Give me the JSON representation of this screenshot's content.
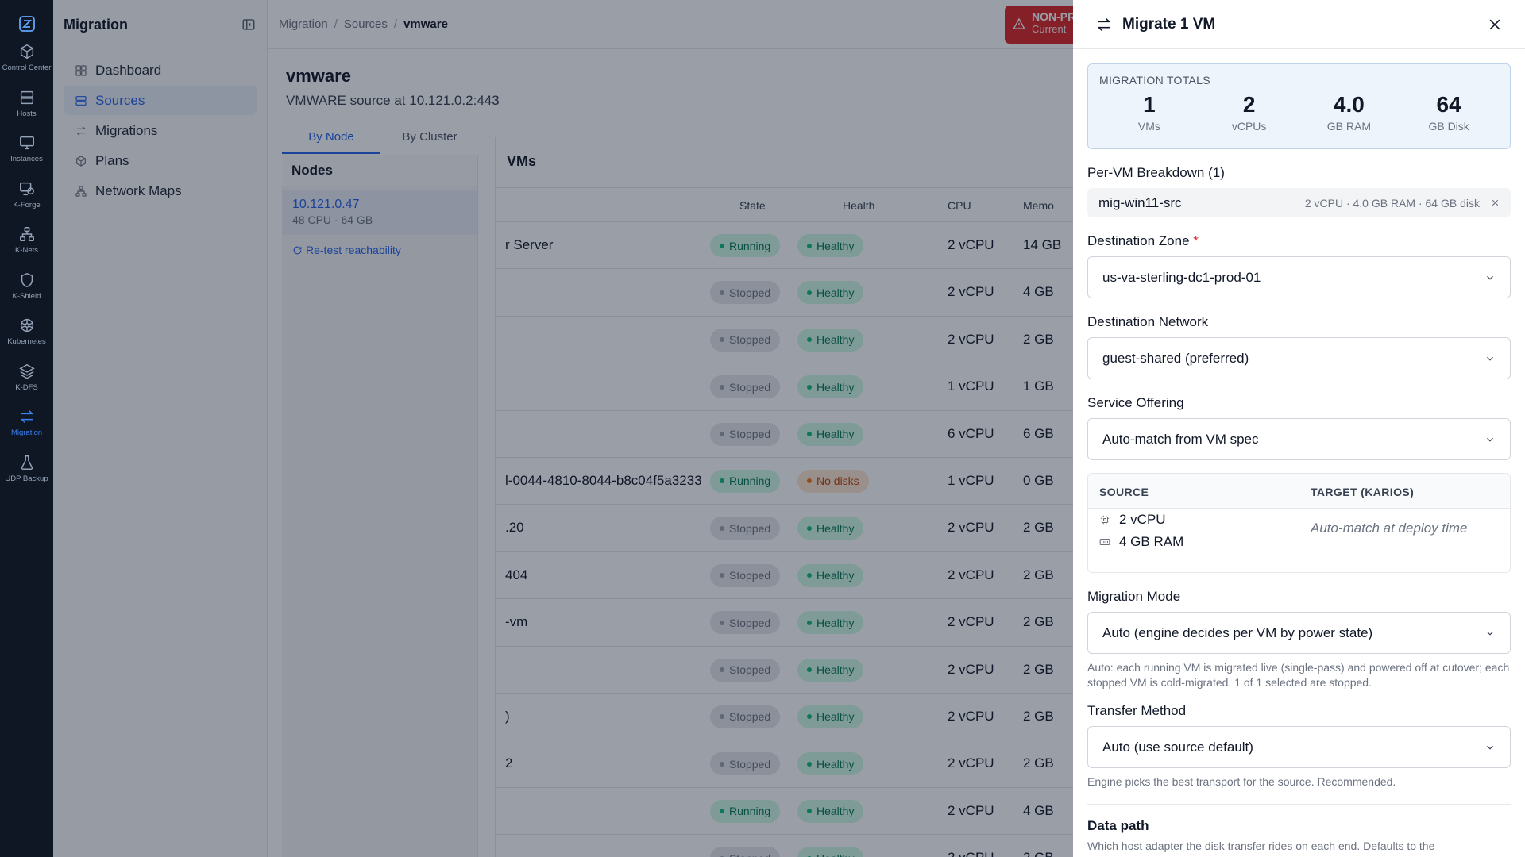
{
  "rail": {
    "items": [
      {
        "label": "Control Center",
        "icon": "cube-icon"
      },
      {
        "label": "Hosts",
        "icon": "server-icon"
      },
      {
        "label": "Instances",
        "icon": "monitor-icon"
      },
      {
        "label": "K-Forge",
        "icon": "forge-icon"
      },
      {
        "label": "K-Nets",
        "icon": "network-icon"
      },
      {
        "label": "K-Shield",
        "icon": "shield-icon"
      },
      {
        "label": "Kubernetes",
        "icon": "kubernetes-icon"
      },
      {
        "label": "K-DFS",
        "icon": "layers-icon"
      },
      {
        "label": "Migration",
        "icon": "swap-icon"
      },
      {
        "label": "UDP Backup",
        "icon": "flask-icon"
      }
    ]
  },
  "nav": {
    "title": "Migration",
    "items": [
      {
        "label": "Dashboard"
      },
      {
        "label": "Sources"
      },
      {
        "label": "Migrations"
      },
      {
        "label": "Plans"
      },
      {
        "label": "Network Maps"
      }
    ]
  },
  "breadcrumb": {
    "c1": "Migration",
    "c2": "Sources",
    "c3": "vmware",
    "sep": "/"
  },
  "alert": {
    "title": "NON-PR",
    "text": "Current"
  },
  "page": {
    "title": "vmware",
    "subtitle": "VMWARE source at 10.121.0.2:443"
  },
  "tabs": {
    "by_node": "By Node",
    "by_cluster": "By Cluster"
  },
  "nodes": {
    "heading": "Nodes",
    "item": {
      "ip": "10.121.0.47",
      "meta": "48 CPU · 64 GB"
    },
    "retest": "Re-test reachability"
  },
  "vms": {
    "heading": "VMs",
    "columns": {
      "state": "State",
      "health": "Health",
      "cpu": "CPU",
      "memory": "Memo"
    },
    "rows": [
      {
        "name": "r Server",
        "state": "Running",
        "health": "Healthy",
        "cpu": "2 vCPU",
        "mem": "14 GB"
      },
      {
        "name": "",
        "state": "Stopped",
        "health": "Healthy",
        "cpu": "2 vCPU",
        "mem": "4 GB"
      },
      {
        "name": "",
        "state": "Stopped",
        "health": "Healthy",
        "cpu": "2 vCPU",
        "mem": "2 GB"
      },
      {
        "name": "",
        "state": "Stopped",
        "health": "Healthy",
        "cpu": "1 vCPU",
        "mem": "1 GB"
      },
      {
        "name": "",
        "state": "Stopped",
        "health": "Healthy",
        "cpu": "6 vCPU",
        "mem": "6 GB"
      },
      {
        "name": "l-0044-4810-8044-b8c04f5a3233",
        "state": "Running",
        "health": "No disks",
        "cpu": "1 vCPU",
        "mem": "0 GB"
      },
      {
        "name": ".20",
        "state": "Stopped",
        "health": "Healthy",
        "cpu": "2 vCPU",
        "mem": "2 GB"
      },
      {
        "name": "404",
        "state": "Stopped",
        "health": "Healthy",
        "cpu": "2 vCPU",
        "mem": "2 GB"
      },
      {
        "name": "-vm",
        "state": "Stopped",
        "health": "Healthy",
        "cpu": "2 vCPU",
        "mem": "2 GB"
      },
      {
        "name": "",
        "state": "Stopped",
        "health": "Healthy",
        "cpu": "2 vCPU",
        "mem": "2 GB"
      },
      {
        "name": ")",
        "state": "Stopped",
        "health": "Healthy",
        "cpu": "2 vCPU",
        "mem": "2 GB"
      },
      {
        "name": "2",
        "state": "Stopped",
        "health": "Healthy",
        "cpu": "2 vCPU",
        "mem": "2 GB"
      },
      {
        "name": "",
        "state": "Running",
        "health": "Healthy",
        "cpu": "2 vCPU",
        "mem": "4 GB"
      },
      {
        "name": "",
        "state": "Stopped",
        "health": "Healthy",
        "cpu": "2 vCPU",
        "mem": "2 GB"
      }
    ]
  },
  "drawer": {
    "title": "Migrate 1 VM",
    "totals": {
      "label": "MIGRATION TOTALS",
      "items": [
        {
          "num": "1",
          "label": "VMs"
        },
        {
          "num": "2",
          "label": "vCPUs"
        },
        {
          "num": "4.0",
          "label": "GB RAM"
        },
        {
          "num": "64",
          "label": "GB Disk"
        }
      ]
    },
    "breakdown": {
      "label": "Per-VM Breakdown (1)",
      "vm_name": "mig-win11-src",
      "vm_spec": "2 vCPU · 4.0 GB RAM · 64 GB disk"
    },
    "zone": {
      "label": "Destination Zone",
      "required": "*",
      "value": "us-va-sterling-dc1-prod-01"
    },
    "network": {
      "label": "Destination Network",
      "value": "guest-shared (preferred)"
    },
    "offering": {
      "label": "Service Offering",
      "value": "Auto-match from VM spec"
    },
    "st": {
      "source_h": "SOURCE",
      "target_h": "TARGET (KARIOS)",
      "cpu": "2 vCPU",
      "ram": "4 GB RAM",
      "target": "Auto-match at deploy time"
    },
    "mode": {
      "label": "Migration Mode",
      "value": "Auto (engine decides per VM by power state)",
      "help": "Auto: each running VM is migrated live (single-pass) and powered off at cutover; each stopped VM is cold-migrated. 1 of 1 selected are stopped."
    },
    "transfer": {
      "label": "Transfer Method",
      "value": "Auto (use source default)",
      "help": "Engine picks the best transport for the source. Recommended."
    },
    "datapath": {
      "title": "Data path",
      "text": "Which host adapter the disk transfer rides on each end. Defaults to the"
    }
  },
  "colors": {
    "accent": "#2563eb",
    "rail_bg": "#0f1724",
    "alert": "#dc2626",
    "running": "#10b981",
    "warning": "#f97316"
  }
}
